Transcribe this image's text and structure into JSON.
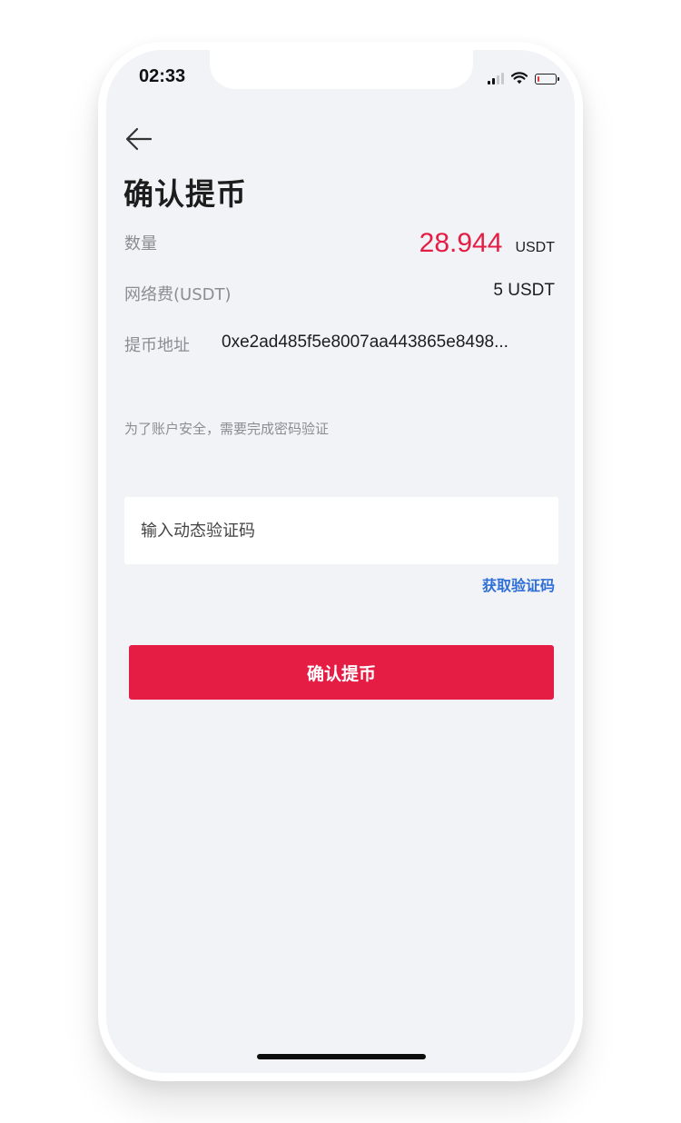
{
  "status_bar": {
    "time": "02:33",
    "icons": [
      "signal-icon",
      "wifi-icon",
      "battery-icon"
    ],
    "battery_level": 0.12,
    "battery_color": "#e03a3a"
  },
  "header": {
    "back_icon": "arrow-left-icon",
    "title": "确认提币"
  },
  "details": {
    "amount_label": "数量",
    "amount_value": "28.944",
    "amount_unit": "USDT",
    "fee_label": "网络费(USDT)",
    "fee_value": "5 USDT",
    "address_label": "提币地址",
    "address_value": "0xe2ad485f5e8007aa443865e8498..."
  },
  "security": {
    "note": "为了账户安全，需要完成密码验证",
    "code_placeholder": "输入动态验证码",
    "get_code_label": "获取验证码"
  },
  "actions": {
    "confirm_label": "确认提币"
  },
  "colors": {
    "accent": "#e51c44",
    "link": "#2f6fd6",
    "background": "#f1f3f7"
  }
}
